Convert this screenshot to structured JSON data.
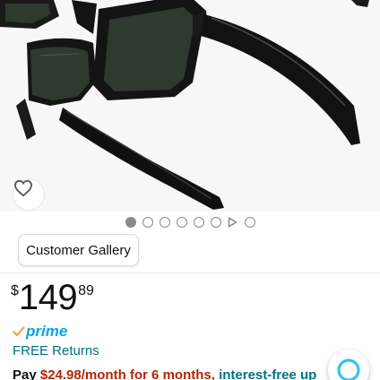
{
  "product_image": {
    "icon": "sunglasses-product-image",
    "background": "#f7f7f7",
    "frame_color": "#111111",
    "lens_color": "#2f3a2f"
  },
  "wishlist": {
    "icon": "heart-icon"
  },
  "carousel": {
    "total_dots": 8,
    "active_index": 0,
    "video_index": 6
  },
  "gallery_button": {
    "label": "Customer Gallery"
  },
  "price": {
    "symbol": "$",
    "whole": "149",
    "fraction": "89"
  },
  "prime": {
    "label": "prime",
    "icon": "prime-check-icon",
    "color": "#00a8e1"
  },
  "returns": {
    "label": "FREE Returns",
    "color": "#007185"
  },
  "financing": {
    "prefix": "Pay ",
    "amount": "$24.98/month for 6 months,",
    "suffix": " interest-free up",
    "amount_color": "#b12704"
  },
  "alexa": {
    "icon": "alexa-icon",
    "color": "#31c4f3"
  }
}
